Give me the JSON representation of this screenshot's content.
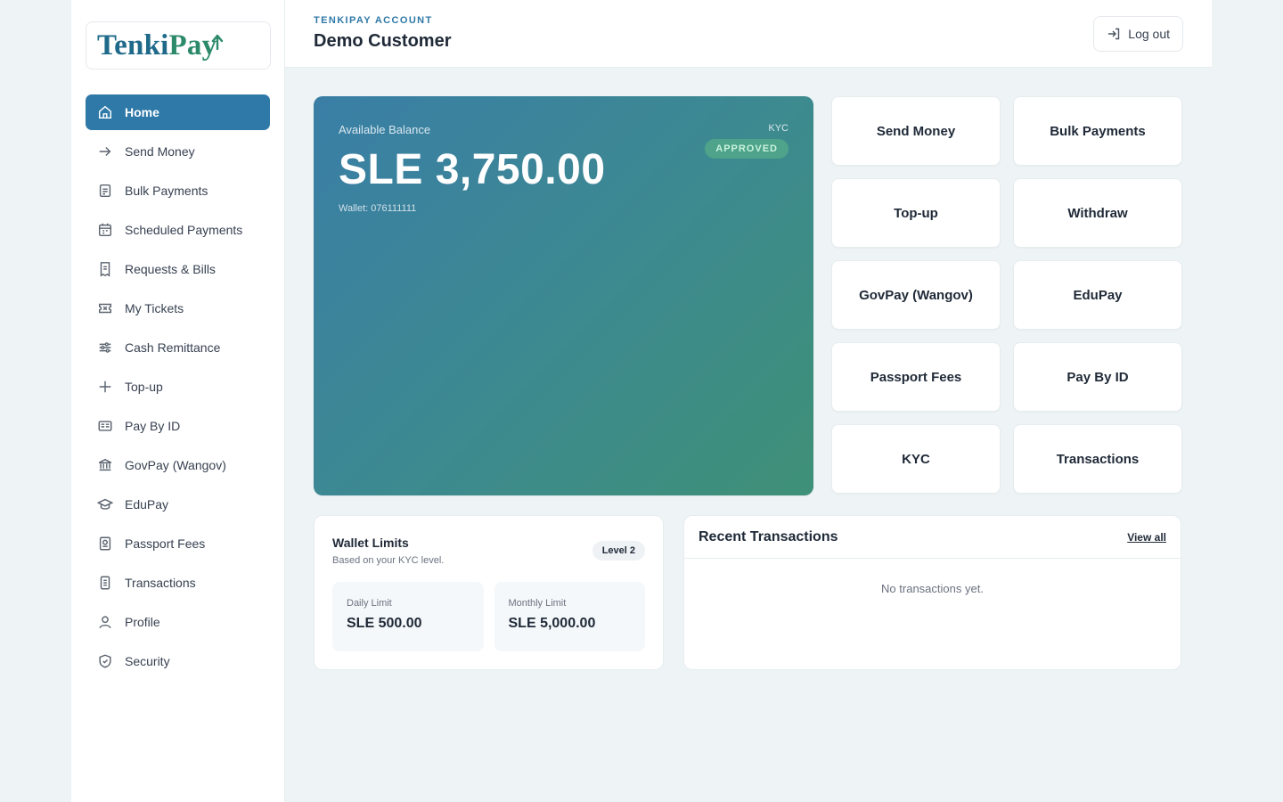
{
  "brand": {
    "logo_text_1": "Tenki",
    "logo_text_2": "Pay"
  },
  "sidebar": {
    "items": [
      {
        "label": "Home",
        "icon": "home-icon",
        "active": true
      },
      {
        "label": "Send Money",
        "icon": "arrow-right-icon"
      },
      {
        "label": "Bulk Payments",
        "icon": "document-icon"
      },
      {
        "label": "Scheduled Payments",
        "icon": "calendar-icon"
      },
      {
        "label": "Requests & Bills",
        "icon": "receipt-icon"
      },
      {
        "label": "My Tickets",
        "icon": "ticket-icon"
      },
      {
        "label": "Cash Remittance",
        "icon": "sliders-icon"
      },
      {
        "label": "Top-up",
        "icon": "plus-icon"
      },
      {
        "label": "Pay By ID",
        "icon": "id-card-icon"
      },
      {
        "label": "GovPay (Wangov)",
        "icon": "bank-icon"
      },
      {
        "label": "EduPay",
        "icon": "graduation-cap-icon"
      },
      {
        "label": "Passport Fees",
        "icon": "passport-icon"
      },
      {
        "label": "Transactions",
        "icon": "list-icon"
      },
      {
        "label": "Profile",
        "icon": "user-icon"
      },
      {
        "label": "Security",
        "icon": "shield-icon"
      }
    ]
  },
  "header": {
    "account_label": "TENKIPAY ACCOUNT",
    "customer_name": "Demo Customer",
    "logout_label": "Log out"
  },
  "balance": {
    "label": "Available Balance",
    "amount": "SLE 3,750.00",
    "wallet": "Wallet: 076111111",
    "kyc_label": "KYC",
    "kyc_status": "APPROVED"
  },
  "actions": [
    "Send Money",
    "Bulk Payments",
    "Top-up",
    "Withdraw",
    "GovPay (Wangov)",
    "EduPay",
    "Passport Fees",
    "Pay By ID",
    "KYC",
    "Transactions"
  ],
  "limits": {
    "title": "Wallet Limits",
    "subtitle": "Based on your KYC level.",
    "level": "Level 2",
    "daily_label": "Daily Limit",
    "daily_value": "SLE 500.00",
    "monthly_label": "Monthly Limit",
    "monthly_value": "SLE 5,000.00"
  },
  "recent": {
    "title": "Recent Transactions",
    "view_all": "View all",
    "empty": "No transactions yet."
  },
  "colors": {
    "accent": "#2e79a8",
    "background": "#eef4f5",
    "card_gradient_start": "#3a7ea6",
    "card_gradient_end": "#3f9077",
    "badge_green": "#4ea38a"
  }
}
